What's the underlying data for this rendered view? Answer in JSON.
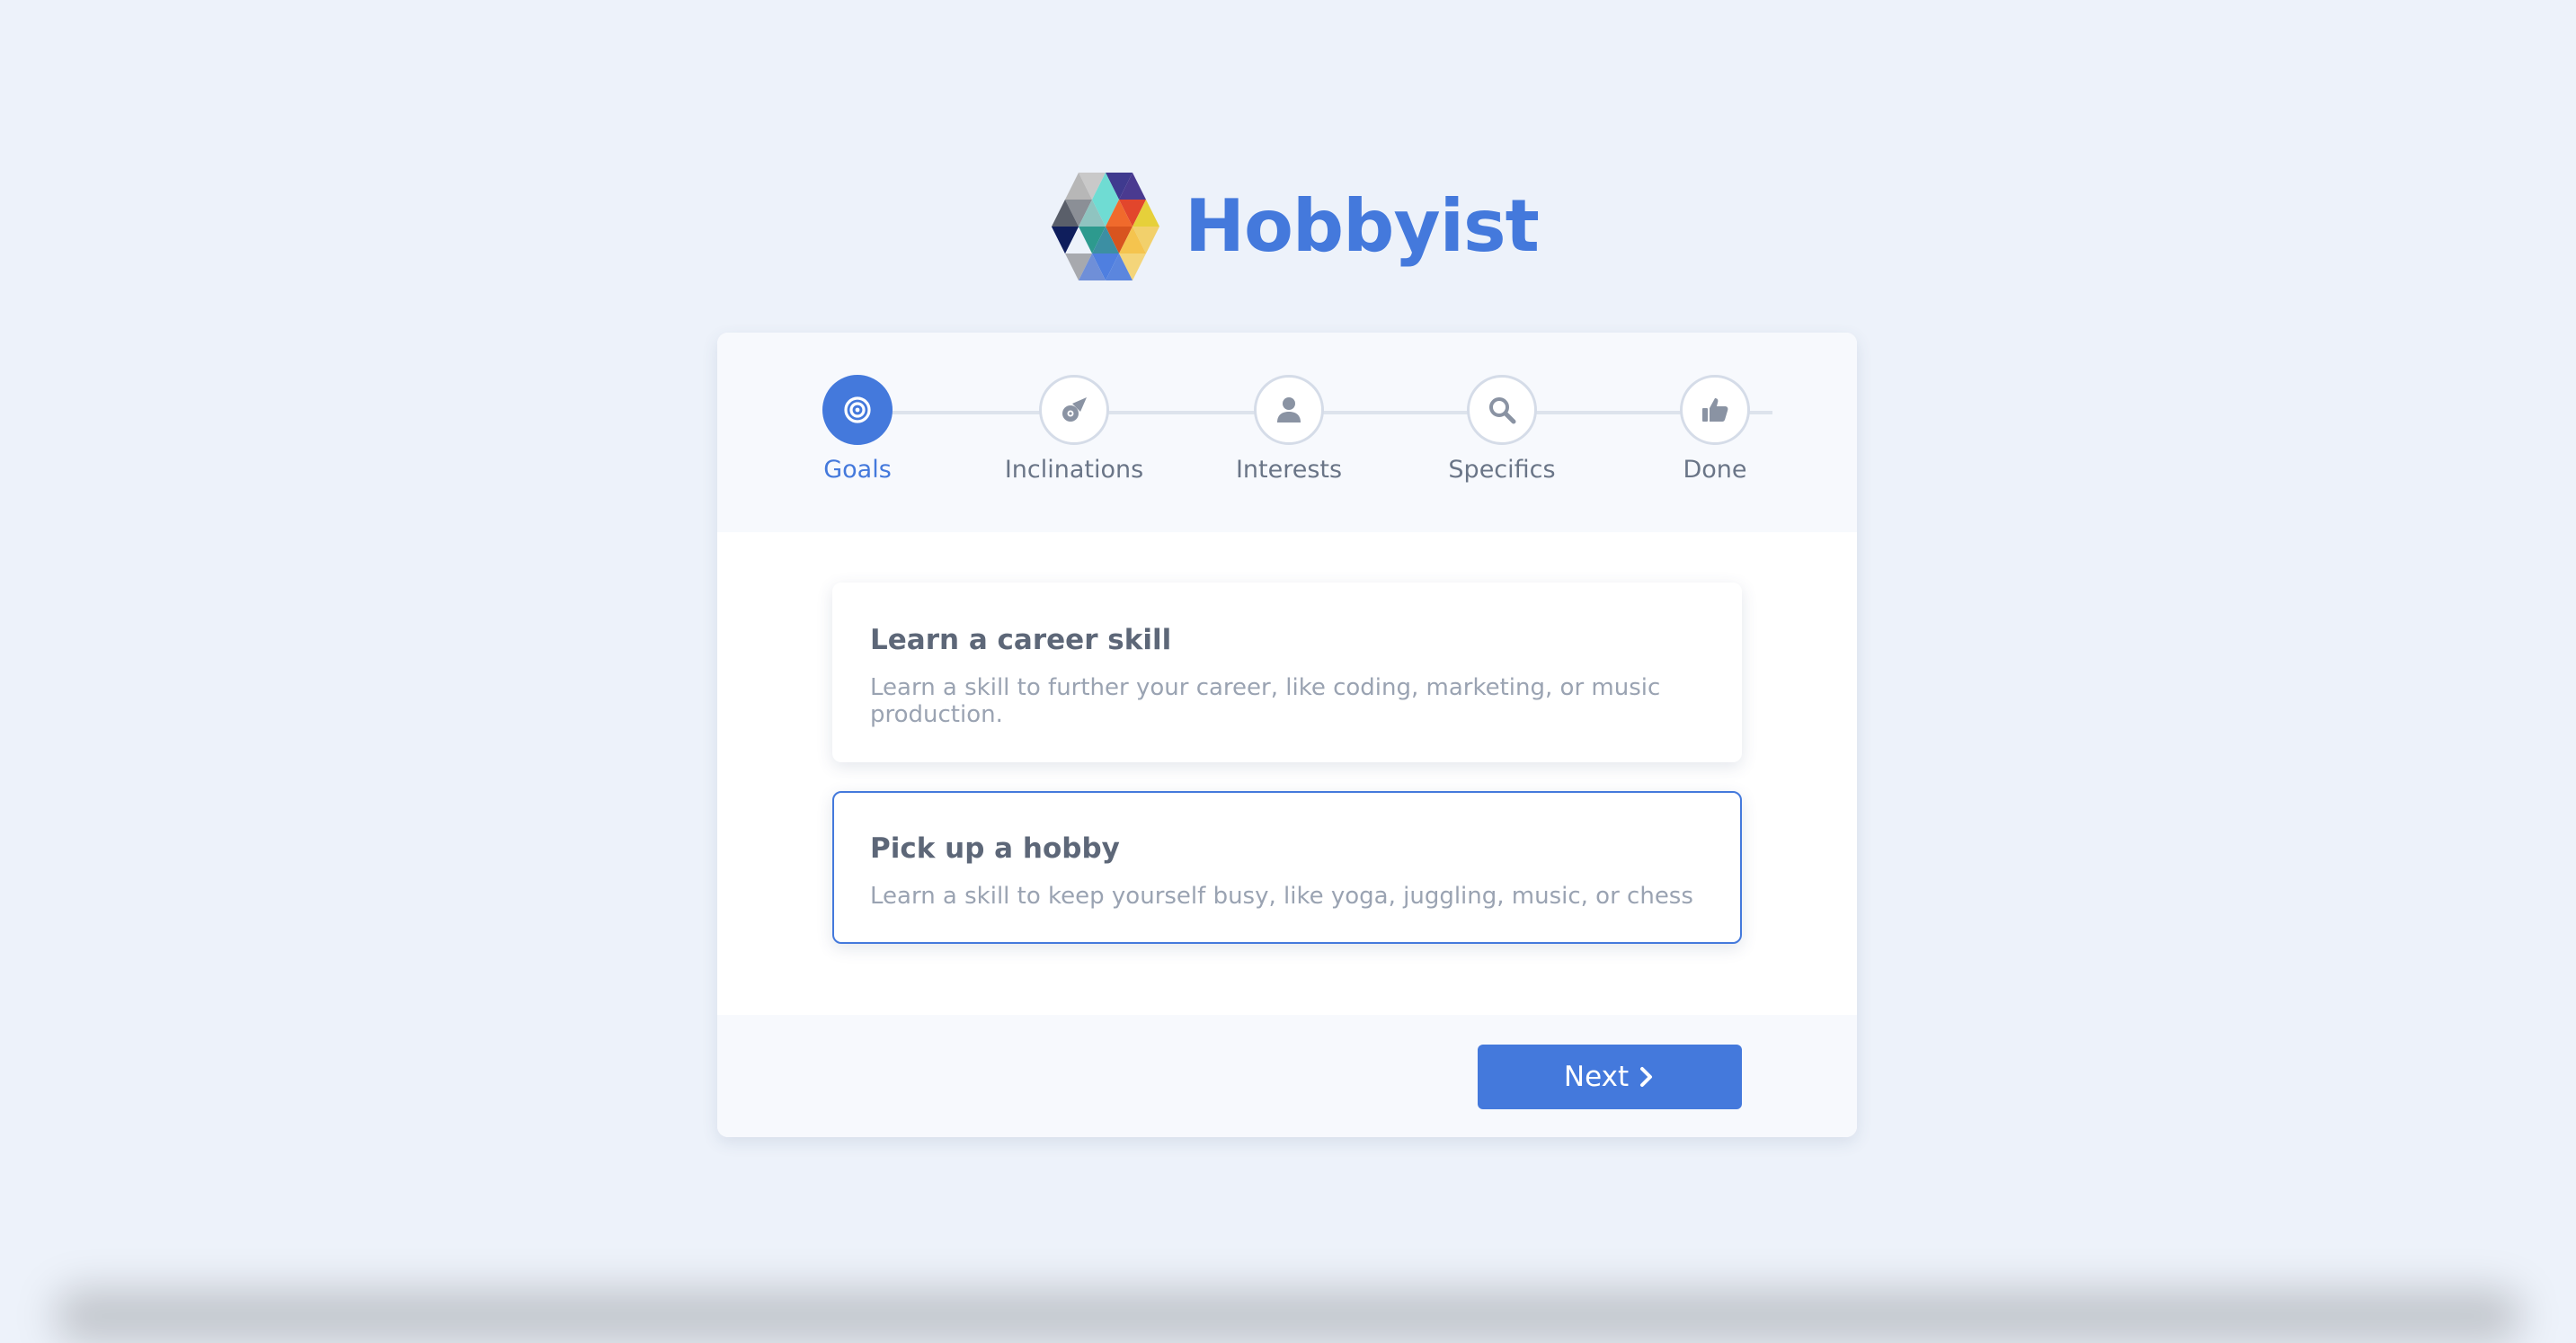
{
  "brand": {
    "name": "Hobbyist",
    "logo_icon": "hexagon-triangle-mosaic-logo",
    "color": "#4479dc"
  },
  "steps": [
    {
      "label": "Goals",
      "icon": "target-icon",
      "active": true
    },
    {
      "label": "Inclinations",
      "icon": "comet-icon",
      "active": false
    },
    {
      "label": "Interests",
      "icon": "person-icon",
      "active": false
    },
    {
      "label": "Specifics",
      "icon": "search-icon",
      "active": false
    },
    {
      "label": "Done",
      "icon": "thumbs-up-icon",
      "active": false
    }
  ],
  "options": [
    {
      "title": "Learn a career skill",
      "description": "Learn a skill to further your career, like coding, marketing, or music production.",
      "selected": false
    },
    {
      "title": "Pick up a hobby",
      "description": "Learn a skill to keep yourself busy, like yoga, juggling, music, or chess",
      "selected": true
    }
  ],
  "footer": {
    "next_label": "Next",
    "next_icon": "chevron-right-icon"
  },
  "colors": {
    "accent": "#4479dc",
    "background": "#edf2fa",
    "muted_text": "#9aa3b2"
  }
}
